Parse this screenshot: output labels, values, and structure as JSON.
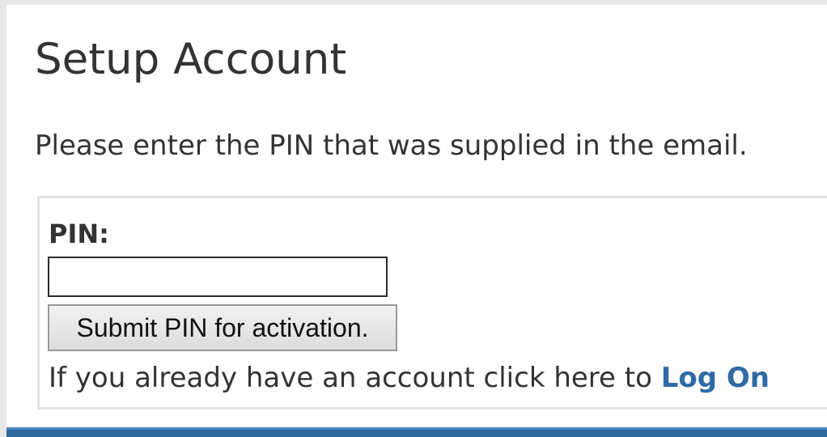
{
  "page": {
    "title": "Setup Account",
    "instructions": "Please enter the PIN that was supplied in the email."
  },
  "form": {
    "pin_label": "PIN:",
    "pin_value": "",
    "submit_label": "Submit PIN for activation.",
    "logon_prompt": "If you already have an account click here to ",
    "logon_link_label": "Log On"
  },
  "colors": {
    "link": "#2f6aa6",
    "footer_bar": "#2e6a9e",
    "text": "#333333"
  }
}
